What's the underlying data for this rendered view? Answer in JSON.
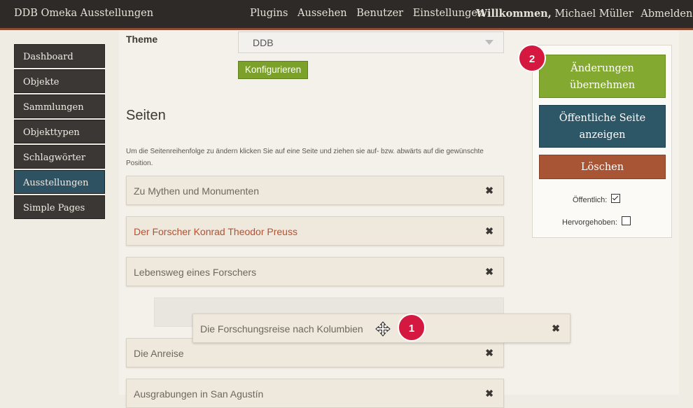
{
  "topbar": {
    "title": "DDB Omeka Ausstellungen",
    "nav": [
      "Plugins",
      "Aussehen",
      "Benutzer",
      "Einstellungen"
    ],
    "welcome": "Willkommen,",
    "user": "Michael Müller",
    "logout": "Abmelden"
  },
  "sidebar": {
    "items": [
      "Dashboard",
      "Objekte",
      "Sammlungen",
      "Objekttypen",
      "Schlagwörter",
      "Ausstellungen",
      "Simple Pages"
    ],
    "active_index": 5
  },
  "theme": {
    "label": "Theme",
    "value": "DDB",
    "configure_label": "Konfigurieren"
  },
  "pages": {
    "title": "Seiten",
    "hint": "Um die Seitenreihenfolge zu ändern klicken Sie auf eine Seite und ziehen sie auf- bzw. abwärts auf die gewünschte Position.",
    "items": [
      "Zu Mythen und Monumenten",
      "Der Forscher Konrad Theodor Preuss",
      "Lebensweg eines Forschers",
      "Die Anreise",
      "Ausgrabungen in San Agustín"
    ],
    "dragging_item": "Die Forschungsreise nach Kolumbien",
    "remove_symbol": "✖"
  },
  "badges": {
    "first": "1",
    "second": "2"
  },
  "panel": {
    "save_label": "Änderungen übernehmen",
    "view_label": "Öffentliche Seite anzeigen",
    "delete_label": "Löschen",
    "public_label": "Öffentlich:",
    "public_checked": true,
    "featured_label": "Hervorgehoben:",
    "featured_checked": false
  },
  "colors": {
    "topbar": "#2d2a27",
    "accent_border": "#8e4a32",
    "save": "#84a930",
    "view": "#2d5666",
    "delete": "#a85535",
    "badge": "#d4183f",
    "active_nav": "#2e5262"
  },
  "icons": [
    "move-icon",
    "close-icon",
    "chevron-down-icon"
  ]
}
